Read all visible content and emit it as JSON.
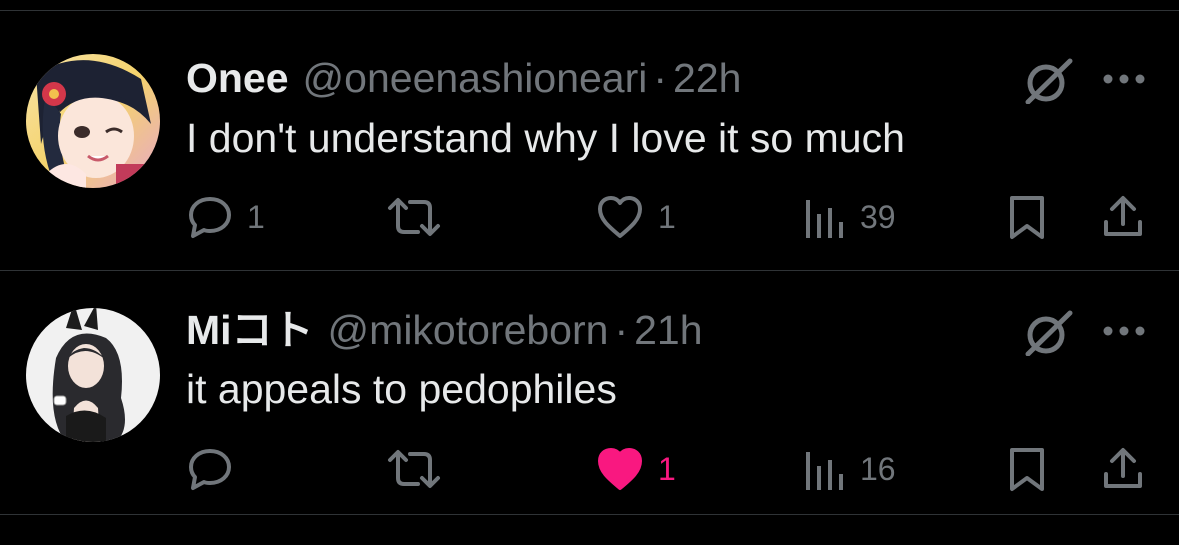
{
  "colors": {
    "background": "#000000",
    "text_primary": "#e7e9ea",
    "text_secondary": "#71767b",
    "divider": "#2f3336",
    "like_active": "#f91880"
  },
  "posts": [
    {
      "display_name": "Onee",
      "handle": "@oneenashioneari",
      "separator": "·",
      "time": "22h",
      "text": "I don't understand why I love it so much",
      "reply_count": "1",
      "retweet_count": "",
      "like_count": "1",
      "liked": false,
      "view_count": "39",
      "icons": [
        "grok-icon",
        "more-icon",
        "reply-icon",
        "retweet-icon",
        "like-icon",
        "views-icon",
        "bookmark-icon",
        "share-icon"
      ]
    },
    {
      "display_name": "Miコト",
      "handle": "@mikotoreborn",
      "separator": "·",
      "time": "21h",
      "text": "it appeals to pedophiles",
      "reply_count": "",
      "retweet_count": "",
      "like_count": "1",
      "liked": true,
      "view_count": "16",
      "icons": [
        "grok-icon",
        "more-icon",
        "reply-icon",
        "retweet-icon",
        "like-filled-icon",
        "views-icon",
        "bookmark-icon",
        "share-icon"
      ]
    }
  ]
}
